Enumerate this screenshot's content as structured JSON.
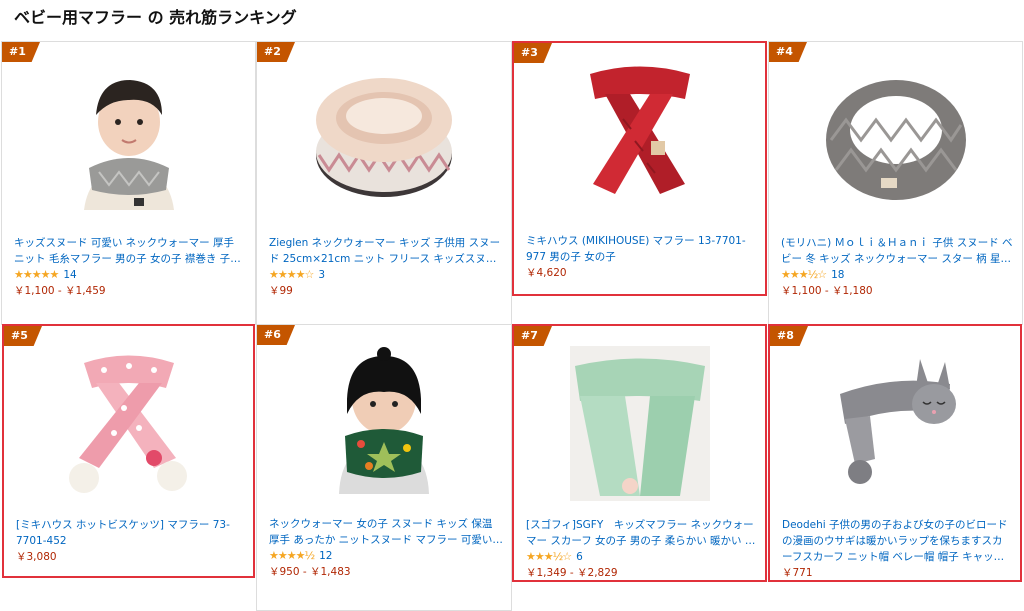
{
  "page": {
    "title": "ベビー用マフラー の 売れ筋ランキング"
  },
  "colors": {
    "badge": "#c45500",
    "link": "#0066c0",
    "price": "#b12704",
    "star": "#f5a623",
    "highlight": "#e1313b"
  },
  "products": [
    {
      "rank": "#1",
      "name": "キッズスヌード 可愛い ネックウォーマー 厚手 ニット 毛糸マフラー 男の子 女の子 襟巻き 子ども…",
      "stars": "★★★★★",
      "rating": 4.5,
      "reviews": "14",
      "price": "￥1,100 - ￥1,459",
      "image": "boy-gray-knit-snood"
    },
    {
      "rank": "#2",
      "name": "Zieglen ネックウォーマー キッズ 子供用 スヌード 25cm×21cm ニット フリース キッズスヌード…",
      "stars": "★★★★☆",
      "rating": 4.0,
      "reviews": "3",
      "price": "￥99",
      "image": "fleece-patterned-snood"
    },
    {
      "rank": "#3",
      "name": "ミキハウス (MIKIHOUSE) マフラー 13-7701-977 男の子 女の子",
      "stars": "",
      "rating": null,
      "reviews": "",
      "price": "￥4,620",
      "image": "red-knit-scarf"
    },
    {
      "rank": "#4",
      "name": "(モリハニ) Ｍｏｌｉ＆Ｈａｎｉ 子供 スヌード ベビー 冬 キッズ ネックウォーマー スター 柄 星…",
      "stars": "★★★½☆",
      "rating": 3.5,
      "reviews": "18",
      "price": "￥1,100 - ￥1,180",
      "image": "gray-knit-snood"
    },
    {
      "rank": "#5",
      "name": "[ミキハウス ホットビスケッツ] マフラー 73-7701-452",
      "stars": "",
      "rating": null,
      "reviews": "",
      "price": "￥3,080",
      "image": "pink-dotted-scarf"
    },
    {
      "rank": "#6",
      "name": "ネックウォーマー 女の子 スヌード キッズ 保温 厚手 あったか ニットスヌード マフラー 可愛い 星…",
      "stars": "★★★★½",
      "rating": 4.5,
      "reviews": "12",
      "price": "￥950 - ￥1,483",
      "image": "girl-green-snood"
    },
    {
      "rank": "#7",
      "name": "[スゴフィ]SGFY　キッズマフラー ネックウォーマー スカーフ 女の子 男の子 柔らかい 暖かい 子供…",
      "stars": "★★★½☆",
      "rating": 3.5,
      "reviews": "6",
      "price": "￥1,349 - ￥2,829",
      "image": "mint-fur-scarf"
    },
    {
      "rank": "#8",
      "name": "Deodehi 子供の男の子および女の子のビロードの漫画のウサギは暖かいラップを保ちますスカーフスカーフ ニット帽 ベレー帽 帽子 キャップ…",
      "stars": "",
      "rating": null,
      "reviews": "",
      "price": "￥771",
      "image": "gray-bunny-scarf"
    }
  ]
}
